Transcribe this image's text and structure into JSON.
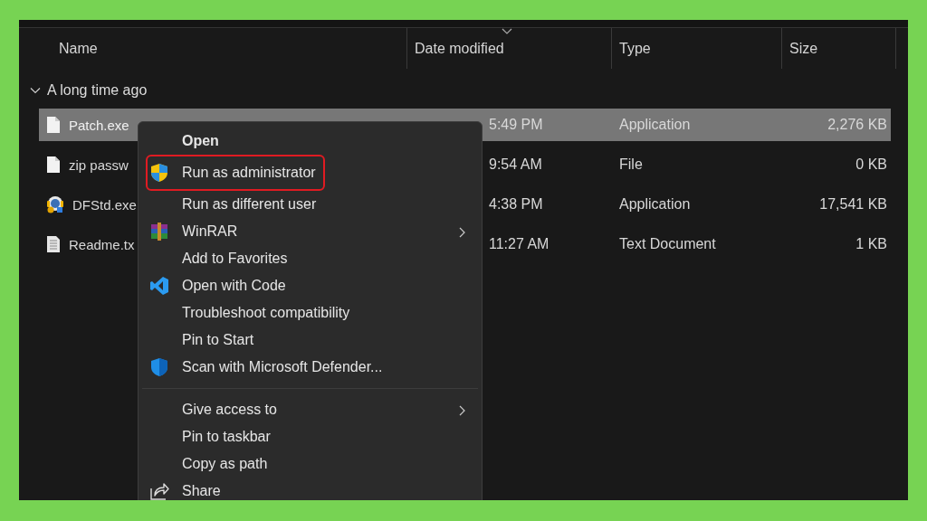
{
  "columns": [
    {
      "label": "Name",
      "sorted": false
    },
    {
      "label": "Date modified",
      "sorted": true
    },
    {
      "label": "Type",
      "sorted": false
    },
    {
      "label": "Size",
      "sorted": false
    }
  ],
  "group": {
    "label": "A long time ago",
    "expanded": true
  },
  "files": [
    {
      "name": "Patch.exe",
      "date": "5:49 PM",
      "type": "Application",
      "size": "2,276 KB",
      "selected": true
    },
    {
      "name": "zip passw",
      "date": "9:54 AM",
      "type": "File",
      "size": "0 KB",
      "selected": false
    },
    {
      "name": "DFStd.exe",
      "date": "4:38 PM",
      "type": "Application",
      "size": "17,541 KB",
      "selected": false
    },
    {
      "name": "Readme.tx",
      "date": "11:27 AM",
      "type": "Text Document",
      "size": "1 KB",
      "selected": false
    }
  ],
  "menu": {
    "items": [
      {
        "kind": "item",
        "label": "Open",
        "default": true,
        "submenu": false,
        "highlighted": false
      },
      {
        "kind": "item",
        "label": "Run as administrator",
        "default": false,
        "submenu": false,
        "highlighted": true
      },
      {
        "kind": "item",
        "label": "Run as different user",
        "default": false,
        "submenu": false,
        "highlighted": false
      },
      {
        "kind": "item",
        "label": "WinRAR",
        "default": false,
        "submenu": true,
        "highlighted": false
      },
      {
        "kind": "item",
        "label": "Add to Favorites",
        "default": false,
        "submenu": false,
        "highlighted": false
      },
      {
        "kind": "item",
        "label": "Open with Code",
        "default": false,
        "submenu": false,
        "highlighted": false
      },
      {
        "kind": "item",
        "label": "Troubleshoot compatibility",
        "default": false,
        "submenu": false,
        "highlighted": false
      },
      {
        "kind": "item",
        "label": "Pin to Start",
        "default": false,
        "submenu": false,
        "highlighted": false
      },
      {
        "kind": "item",
        "label": "Scan with Microsoft Defender...",
        "default": false,
        "submenu": false,
        "highlighted": false
      },
      {
        "kind": "separator"
      },
      {
        "kind": "item",
        "label": "Give access to",
        "default": false,
        "submenu": true,
        "highlighted": false
      },
      {
        "kind": "item",
        "label": "Pin to taskbar",
        "default": false,
        "submenu": false,
        "highlighted": false
      },
      {
        "kind": "item",
        "label": "Copy as path",
        "default": false,
        "submenu": false,
        "highlighted": false
      },
      {
        "kind": "item",
        "label": "Share",
        "default": false,
        "submenu": false,
        "highlighted": false
      }
    ]
  }
}
